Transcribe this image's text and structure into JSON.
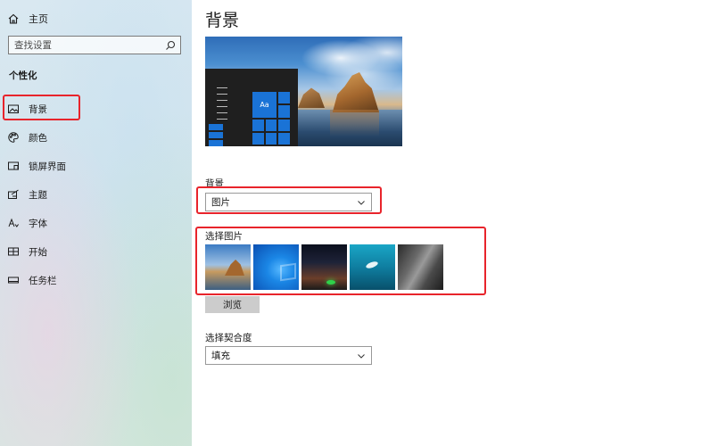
{
  "sidebar": {
    "home_label": "主页",
    "search_placeholder": "查找设置",
    "section_title": "个性化",
    "items": [
      {
        "label": "背景",
        "icon": "image-icon"
      },
      {
        "label": "颜色",
        "icon": "palette-icon"
      },
      {
        "label": "锁屏界面",
        "icon": "lockscreen-icon"
      },
      {
        "label": "主题",
        "icon": "theme-icon"
      },
      {
        "label": "字体",
        "icon": "font-icon"
      },
      {
        "label": "开始",
        "icon": "start-icon"
      },
      {
        "label": "任务栏",
        "icon": "taskbar-icon"
      }
    ],
    "active_item": "背景"
  },
  "main": {
    "title": "背景",
    "preview_tile_text": "Aa",
    "background_label": "背景",
    "background_value": "图片",
    "choose_picture_label": "选择图片",
    "browse_label": "浏览",
    "fit_label": "选择契合度",
    "fit_value": "填充"
  },
  "colors": {
    "accent": "#1a73d6",
    "highlight_box": "#e8242b"
  }
}
